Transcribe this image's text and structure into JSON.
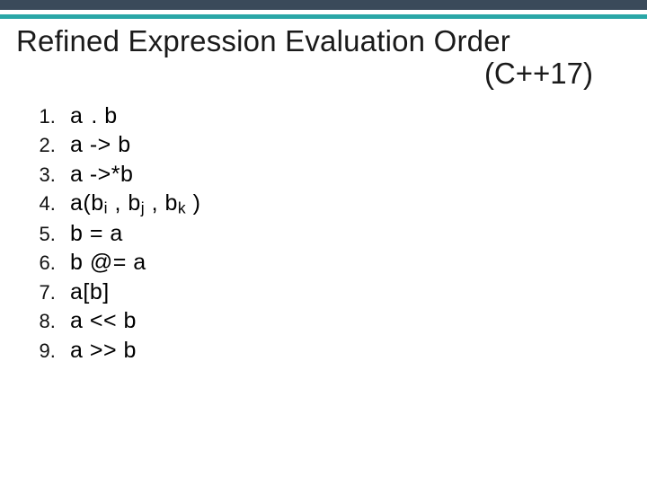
{
  "title": {
    "line1": "Refined Expression Evaluation Order",
    "line2": "(C++17)"
  },
  "expressions": [
    {
      "n": "1",
      "html": "a<span style='letter-spacing:2px'> </span>. b"
    },
    {
      "n": "2",
      "html": "a -&gt; b"
    },
    {
      "n": "3",
      "html": "a -&gt;*b"
    },
    {
      "n": "4",
      "html": "a(b<sub>i</sub> , b<sub>j</sub> , b<sub>k</sub> )"
    },
    {
      "n": "5",
      "html": "b = a"
    },
    {
      "n": "6",
      "html": "b @= a"
    },
    {
      "n": "7",
      "html": "a[b]"
    },
    {
      "n": "8",
      "html": "a &lt;&lt; b"
    },
    {
      "n": "9",
      "html": "a &gt;&gt; b"
    }
  ],
  "colors": {
    "stripe_dark": "#3a4a5a",
    "stripe_teal": "#2aa7a7"
  }
}
